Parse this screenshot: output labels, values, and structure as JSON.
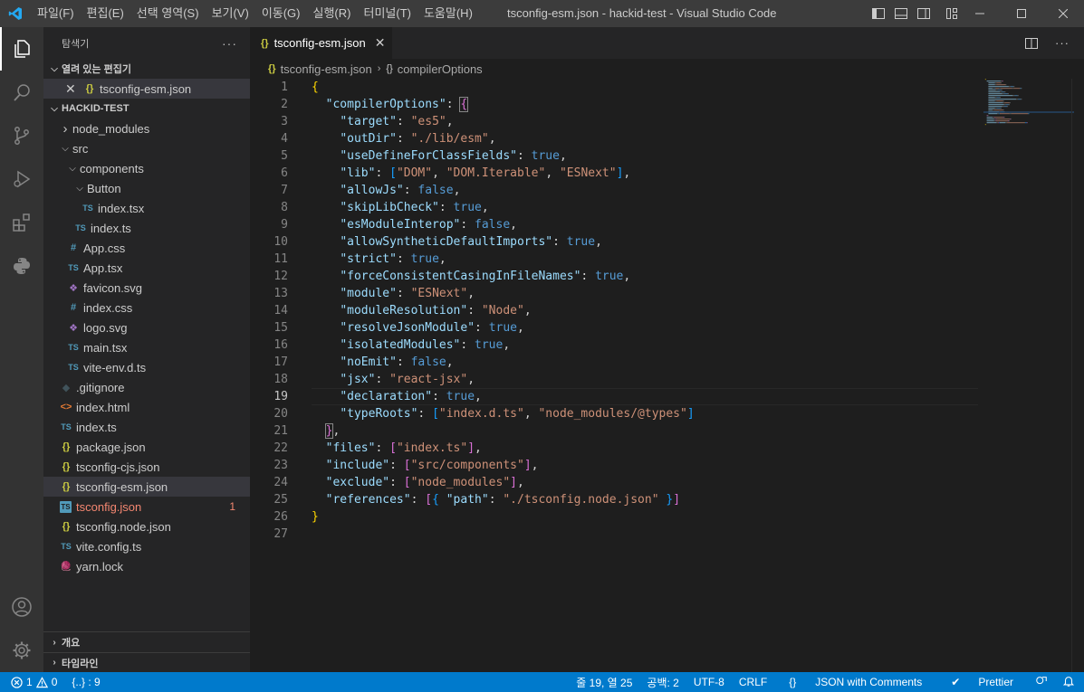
{
  "titlebar": {
    "menu": [
      "파일(F)",
      "편집(E)",
      "선택 영역(S)",
      "보기(V)",
      "이동(G)",
      "실행(R)",
      "터미널(T)",
      "도움말(H)"
    ],
    "title": "tsconfig-esm.json - hackid-test - Visual Studio Code"
  },
  "sidebar": {
    "title": "탐색기",
    "more": "···",
    "open_editors_label": "열려 있는 편집기",
    "open_editor_file": "tsconfig-esm.json",
    "project_label": "HACKID-TEST",
    "tree": [
      {
        "label": "node_modules",
        "kind": "folder",
        "depth": 1,
        "open": false
      },
      {
        "label": "src",
        "kind": "folder",
        "depth": 1,
        "open": true
      },
      {
        "label": "components",
        "kind": "folder",
        "depth": 2,
        "open": true
      },
      {
        "label": "Button",
        "kind": "folder",
        "depth": 3,
        "open": true
      },
      {
        "label": "index.tsx",
        "kind": "ts",
        "depth": 4
      },
      {
        "label": "index.ts",
        "kind": "ts",
        "depth": 3
      },
      {
        "label": "App.css",
        "kind": "css",
        "depth": 2
      },
      {
        "label": "App.tsx",
        "kind": "ts",
        "depth": 2
      },
      {
        "label": "favicon.svg",
        "kind": "svg",
        "depth": 2
      },
      {
        "label": "index.css",
        "kind": "css",
        "depth": 2
      },
      {
        "label": "logo.svg",
        "kind": "svg",
        "depth": 2
      },
      {
        "label": "main.tsx",
        "kind": "ts",
        "depth": 2
      },
      {
        "label": "vite-env.d.ts",
        "kind": "ts",
        "depth": 2
      },
      {
        "label": ".gitignore",
        "kind": "git",
        "depth": 1
      },
      {
        "label": "index.html",
        "kind": "html",
        "depth": 1
      },
      {
        "label": "index.ts",
        "kind": "ts",
        "depth": 1
      },
      {
        "label": "package.json",
        "kind": "json",
        "depth": 1
      },
      {
        "label": "tsconfig-cjs.json",
        "kind": "json",
        "depth": 1
      },
      {
        "label": "tsconfig-esm.json",
        "kind": "json",
        "depth": 1,
        "selected": true
      },
      {
        "label": "tsconfig.json",
        "kind": "tsconf",
        "depth": 1,
        "error": true,
        "badge": "1"
      },
      {
        "label": "tsconfig.node.json",
        "kind": "json",
        "depth": 1
      },
      {
        "label": "vite.config.ts",
        "kind": "ts",
        "depth": 1
      },
      {
        "label": "yarn.lock",
        "kind": "yarn",
        "depth": 1
      }
    ],
    "outline_label": "개요",
    "timeline_label": "타임라인"
  },
  "editor": {
    "tab_label": "tsconfig-esm.json",
    "breadcrumb": [
      "tsconfig-esm.json",
      "compilerOptions"
    ],
    "current_line": 19,
    "lines": [
      [
        [
          "p1",
          "{"
        ]
      ],
      [
        [
          "",
          "  "
        ],
        [
          "k",
          "\"compilerOptions\""
        ],
        [
          "",
          ": "
        ],
        [
          "p2",
          "{"
        ]
      ],
      [
        [
          "",
          "    "
        ],
        [
          "k",
          "\"target\""
        ],
        [
          "",
          ": "
        ],
        [
          "s",
          "\"es5\""
        ],
        [
          "",
          ","
        ]
      ],
      [
        [
          "",
          "    "
        ],
        [
          "k",
          "\"outDir\""
        ],
        [
          "",
          ": "
        ],
        [
          "s",
          "\"./lib/esm\""
        ],
        [
          "",
          ","
        ]
      ],
      [
        [
          "",
          "    "
        ],
        [
          "k",
          "\"useDefineForClassFields\""
        ],
        [
          "",
          ": "
        ],
        [
          "b",
          "true"
        ],
        [
          "",
          ","
        ]
      ],
      [
        [
          "",
          "    "
        ],
        [
          "k",
          "\"lib\""
        ],
        [
          "",
          ": "
        ],
        [
          "p3",
          "["
        ],
        [
          "s",
          "\"DOM\""
        ],
        [
          "",
          ", "
        ],
        [
          "s",
          "\"DOM.Iterable\""
        ],
        [
          "",
          ", "
        ],
        [
          "s",
          "\"ESNext\""
        ],
        [
          "p3",
          "]"
        ],
        [
          "",
          ","
        ]
      ],
      [
        [
          "",
          "    "
        ],
        [
          "k",
          "\"allowJs\""
        ],
        [
          "",
          ": "
        ],
        [
          "b",
          "false"
        ],
        [
          "",
          ","
        ]
      ],
      [
        [
          "",
          "    "
        ],
        [
          "k",
          "\"skipLibCheck\""
        ],
        [
          "",
          ": "
        ],
        [
          "b",
          "true"
        ],
        [
          "",
          ","
        ]
      ],
      [
        [
          "",
          "    "
        ],
        [
          "k",
          "\"esModuleInterop\""
        ],
        [
          "",
          ": "
        ],
        [
          "b",
          "false"
        ],
        [
          "",
          ","
        ]
      ],
      [
        [
          "",
          "    "
        ],
        [
          "k",
          "\"allowSyntheticDefaultImports\""
        ],
        [
          "",
          ": "
        ],
        [
          "b",
          "true"
        ],
        [
          "",
          ","
        ]
      ],
      [
        [
          "",
          "    "
        ],
        [
          "k",
          "\"strict\""
        ],
        [
          "",
          ": "
        ],
        [
          "b",
          "true"
        ],
        [
          "",
          ","
        ]
      ],
      [
        [
          "",
          "    "
        ],
        [
          "k",
          "\"forceConsistentCasingInFileNames\""
        ],
        [
          "",
          ": "
        ],
        [
          "b",
          "true"
        ],
        [
          "",
          ","
        ]
      ],
      [
        [
          "",
          "    "
        ],
        [
          "k",
          "\"module\""
        ],
        [
          "",
          ": "
        ],
        [
          "s",
          "\"ESNext\""
        ],
        [
          "",
          ","
        ]
      ],
      [
        [
          "",
          "    "
        ],
        [
          "k",
          "\"moduleResolution\""
        ],
        [
          "",
          ": "
        ],
        [
          "s",
          "\"Node\""
        ],
        [
          "",
          ","
        ]
      ],
      [
        [
          "",
          "    "
        ],
        [
          "k",
          "\"resolveJsonModule\""
        ],
        [
          "",
          ": "
        ],
        [
          "b",
          "true"
        ],
        [
          "",
          ","
        ]
      ],
      [
        [
          "",
          "    "
        ],
        [
          "k",
          "\"isolatedModules\""
        ],
        [
          "",
          ": "
        ],
        [
          "b",
          "true"
        ],
        [
          "",
          ","
        ]
      ],
      [
        [
          "",
          "    "
        ],
        [
          "k",
          "\"noEmit\""
        ],
        [
          "",
          ": "
        ],
        [
          "b",
          "false"
        ],
        [
          "",
          ","
        ]
      ],
      [
        [
          "",
          "    "
        ],
        [
          "k",
          "\"jsx\""
        ],
        [
          "",
          ": "
        ],
        [
          "s",
          "\"react-jsx\""
        ],
        [
          "",
          ","
        ]
      ],
      [
        [
          "",
          "    "
        ],
        [
          "k",
          "\"declaration\""
        ],
        [
          "",
          ": "
        ],
        [
          "b",
          "true"
        ],
        [
          "",
          ","
        ]
      ],
      [
        [
          "",
          "    "
        ],
        [
          "k",
          "\"typeRoots\""
        ],
        [
          "",
          ": "
        ],
        [
          "p3",
          "["
        ],
        [
          "s",
          "\"index.d.ts\""
        ],
        [
          "",
          ", "
        ],
        [
          "s",
          "\"node_modules/@types\""
        ],
        [
          "p3",
          "]"
        ]
      ],
      [
        [
          "",
          "  "
        ],
        [
          "p2",
          "}"
        ],
        [
          "",
          ","
        ]
      ],
      [
        [
          "",
          "  "
        ],
        [
          "k",
          "\"files\""
        ],
        [
          "",
          ": "
        ],
        [
          "p2",
          "["
        ],
        [
          "s",
          "\"index.ts\""
        ],
        [
          "p2",
          "]"
        ],
        [
          "",
          ","
        ]
      ],
      [
        [
          "",
          "  "
        ],
        [
          "k",
          "\"include\""
        ],
        [
          "",
          ": "
        ],
        [
          "p2",
          "["
        ],
        [
          "s",
          "\"src/components\""
        ],
        [
          "p2",
          "]"
        ],
        [
          "",
          ","
        ]
      ],
      [
        [
          "",
          "  "
        ],
        [
          "k",
          "\"exclude\""
        ],
        [
          "",
          ": "
        ],
        [
          "p2",
          "["
        ],
        [
          "s",
          "\"node_modules\""
        ],
        [
          "p2",
          "]"
        ],
        [
          "",
          ","
        ]
      ],
      [
        [
          "",
          "  "
        ],
        [
          "k",
          "\"references\""
        ],
        [
          "",
          ": "
        ],
        [
          "p2",
          "["
        ],
        [
          "p3",
          "{"
        ],
        [
          "",
          ""
        ],
        [
          "k",
          " \"path\""
        ],
        [
          "",
          ": "
        ],
        [
          "s",
          "\"./tsconfig.node.json\""
        ],
        [
          "p3",
          " }"
        ],
        [
          "p2",
          "]"
        ]
      ],
      [
        [
          "p1",
          "}"
        ]
      ],
      [
        [
          "",
          ""
        ]
      ]
    ]
  },
  "statusbar": {
    "errors": "1",
    "warnings": "0",
    "json_path": "{..} : 9",
    "position": "줄 19, 열 25",
    "indent": "공백: 2",
    "encoding": "UTF-8",
    "eol": "CRLF",
    "language": "JSON with Comments",
    "formatter": "Prettier"
  },
  "colors": {
    "accent": "#007acc",
    "error": "#f48771",
    "json_icon": "#cbcb41",
    "ts_icon": "#519aba"
  },
  "icons": {
    "explorer": "files-icon",
    "search": "search-icon",
    "scm": "source-control-icon",
    "debug": "run-debug-icon",
    "extensions": "extensions-icon",
    "python": "python-icon",
    "account": "account-icon",
    "settings": "gear-icon"
  }
}
